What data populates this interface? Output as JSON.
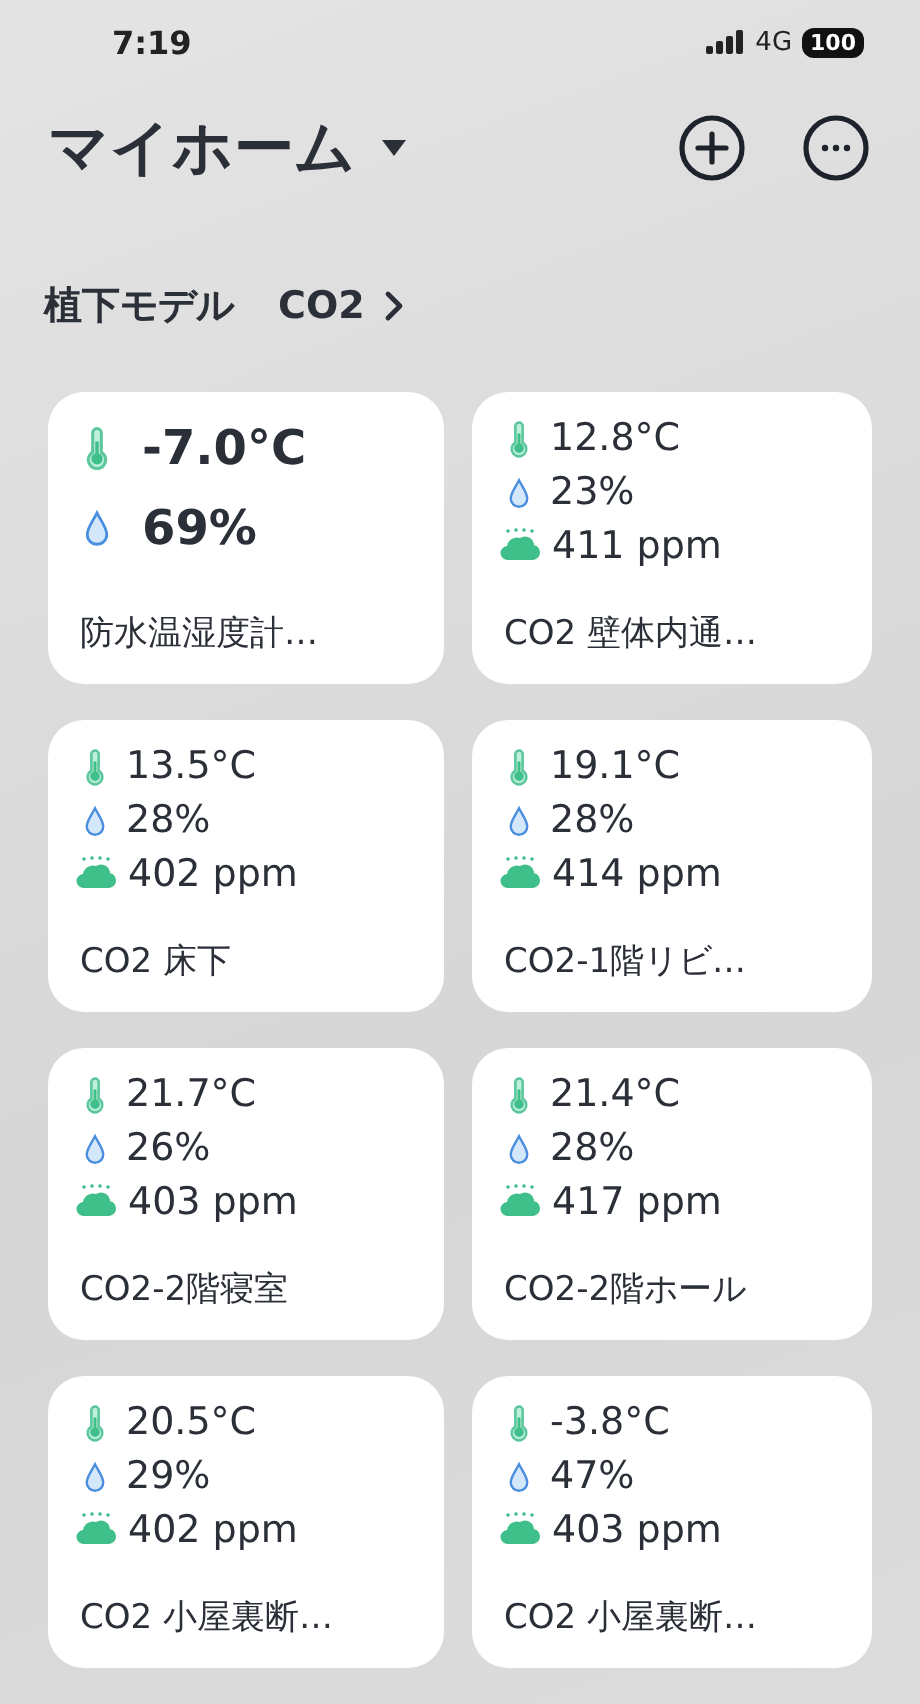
{
  "status_bar": {
    "time": "7:19",
    "network": "4G",
    "battery": "100"
  },
  "header": {
    "title": "マイホーム"
  },
  "section": {
    "title": "植下モデル",
    "subtitle": "CO2"
  },
  "devices": [
    {
      "kind": "large",
      "temperature": "-7.0°C",
      "humidity": "69%",
      "name": "防水温湿度計…"
    },
    {
      "kind": "compact",
      "temperature": "12.8°C",
      "humidity": "23%",
      "co2": "411 ppm",
      "name": "CO2 壁体内通…"
    },
    {
      "kind": "compact",
      "temperature": "13.5°C",
      "humidity": "28%",
      "co2": "402 ppm",
      "name": "CO2 床下"
    },
    {
      "kind": "compact",
      "temperature": "19.1°C",
      "humidity": "28%",
      "co2": "414 ppm",
      "name": "CO2-1階リビ…"
    },
    {
      "kind": "compact",
      "temperature": "21.7°C",
      "humidity": "26%",
      "co2": "403 ppm",
      "name": "CO2-2階寝室"
    },
    {
      "kind": "compact",
      "temperature": "21.4°C",
      "humidity": "28%",
      "co2": "417 ppm",
      "name": "CO2-2階ホール"
    },
    {
      "kind": "compact",
      "temperature": "20.5°C",
      "humidity": "29%",
      "co2": "402 ppm",
      "name": "CO2 小屋裏断…"
    },
    {
      "kind": "compact",
      "temperature": "-3.8°C",
      "humidity": "47%",
      "co2": "403 ppm",
      "name": "CO2 小屋裏断…"
    }
  ]
}
